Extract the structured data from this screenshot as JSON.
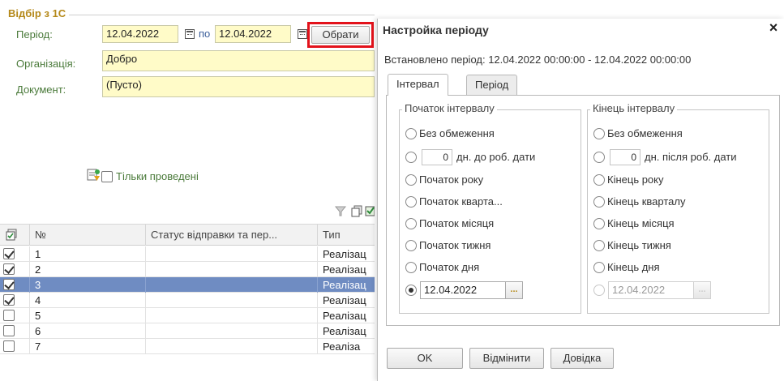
{
  "filter": {
    "group_title": "Відбір з 1С",
    "period_label": "Період:",
    "date_from": "12.04.2022",
    "po_label": "по",
    "date_to": "12.04.2022",
    "choose_button": "Обрати",
    "org_label": "Організація:",
    "org_value": "Добро",
    "doc_label": "Документ:",
    "doc_value": "(Пусто)",
    "only_posted_label": "Тільки проведені"
  },
  "grid": {
    "headers": [
      "№",
      "Статус відправки та пер...",
      "Тип"
    ],
    "rows": [
      {
        "checked": true,
        "num": "1",
        "status": "",
        "type": "Реалізац"
      },
      {
        "checked": true,
        "num": "2",
        "status": "",
        "type": "Реалізац"
      },
      {
        "checked": true,
        "num": "3",
        "status": "",
        "type": "Реалізац",
        "selected": true
      },
      {
        "checked": true,
        "num": "4",
        "status": "",
        "type": "Реалізац"
      },
      {
        "checked": false,
        "num": "5",
        "status": "",
        "type": "Реалізац"
      },
      {
        "checked": false,
        "num": "6",
        "status": "",
        "type": "Реалізац"
      },
      {
        "checked": false,
        "num": "7",
        "status": "",
        "type": "Реаліза"
      }
    ]
  },
  "dialog": {
    "title": "Настройка періоду",
    "close": "×",
    "info": "Встановлено період: 12.04.2022 00:00:00 - 12.04.2022 00:00:00",
    "tabs": [
      "Інтервал",
      "Період"
    ],
    "start": {
      "title": "Початок інтервалу",
      "no_limit": "Без обмеження",
      "days_value": "0",
      "days_label": "дн. до роб. дати",
      "year": "Початок року",
      "quarter": "Початок кварта...",
      "month": "Початок місяця",
      "week": "Початок тижня",
      "day": "Початок дня",
      "date": "12.04.2022"
    },
    "end": {
      "title": "Кінець інтервалу",
      "no_limit": "Без обмеження",
      "days_value": "0",
      "days_label": "дн. після роб. дати",
      "year": "Кінець року",
      "quarter": "Кінець кварталу",
      "month": "Кінець місяця",
      "week": "Кінець тижня",
      "day": "Кінець дня",
      "date": "12.04.2022"
    },
    "ok": "OK",
    "cancel": "Відмінити",
    "help": "Довідка"
  },
  "colors": {
    "highlight_border": "#e3121b",
    "field_bg": "#fffbc8",
    "selected_row": "#6f8cc2",
    "group_title": "#b5891a",
    "label_green": "#4a7a3a"
  }
}
